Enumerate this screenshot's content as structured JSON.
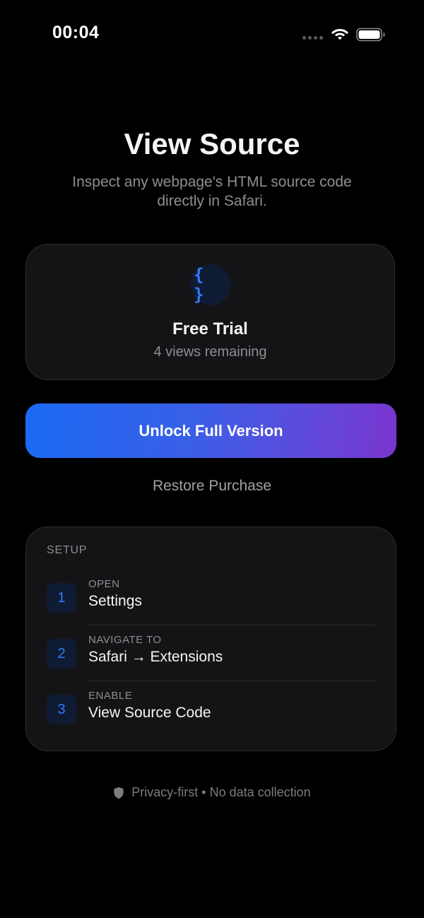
{
  "status_bar": {
    "time": "00:04"
  },
  "header": {
    "title": "View Source",
    "subtitle": "Inspect any webpage's HTML source code directly in Safari."
  },
  "trial_card": {
    "icon": "curly-braces-icon",
    "icon_glyph": "{ }",
    "title": "Free Trial",
    "remaining": "4 views remaining"
  },
  "actions": {
    "unlock_label": "Unlock Full Version",
    "restore_label": "Restore Purchase"
  },
  "setup": {
    "heading": "SETUP",
    "steps": [
      {
        "number": "1",
        "label": "OPEN",
        "value": "Settings"
      },
      {
        "number": "2",
        "label": "NAVIGATE TO",
        "value": "Safari → Extensions"
      },
      {
        "number": "3",
        "label": "ENABLE",
        "value": "View Source Code"
      }
    ]
  },
  "footer": {
    "icon": "shield-icon",
    "text": "Privacy-first • No data collection"
  },
  "colors": {
    "background": "#000000",
    "card": "#141416",
    "accent_blue": "#2f7bf6",
    "gradient_start": "#1b6bf4",
    "gradient_end": "#7a35cf"
  }
}
